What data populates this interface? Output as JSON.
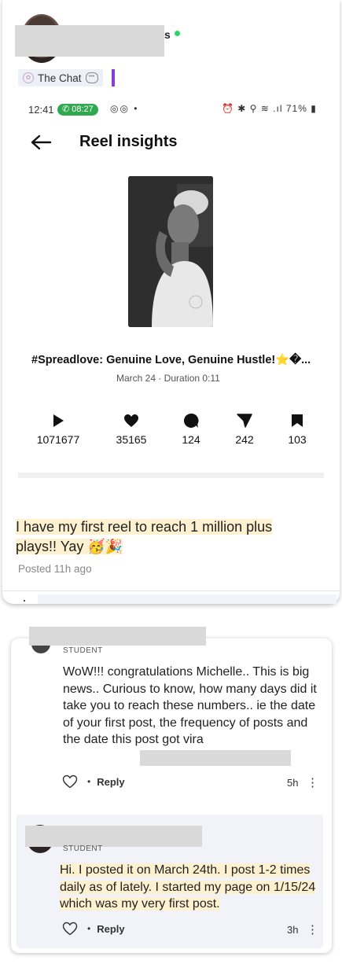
{
  "header": {
    "name_tail": "s",
    "chat_tag_label": "The Chat",
    "close_glyph": "✕",
    "more_glyph": "⋮"
  },
  "phone": {
    "status_time": "12:41",
    "call_time": "08:27",
    "status_left_icons": "◎◎ •",
    "status_right_icons": "⏰ ✱ ⚲ ≋ .ıl",
    "battery": "71%"
  },
  "reel": {
    "title": "Reel insights",
    "caption": "#Spreadlove: Genuine Love, Genuine Hustle!⭐�...",
    "meta": "March 24 · Duration 0:11",
    "stats": [
      {
        "icon": "play-icon",
        "value": "1071677"
      },
      {
        "icon": "heart-icon",
        "value": "35165"
      },
      {
        "icon": "comment-icon",
        "value": "124"
      },
      {
        "icon": "share-icon",
        "value": "242"
      },
      {
        "icon": "bookmark-icon",
        "value": "103"
      }
    ]
  },
  "post": {
    "body_line1": "I have my first reel to reach 1 million plus",
    "body_line2": "plays!! Yay 🥳🎉",
    "posted": "Posted 11h ago"
  },
  "comment": {
    "role": "STUDENT",
    "text": "WoW!!! congratulations Michelle.. This is big news.. Curious to know, how many days did it take you to reach these numbers.. ie the date of your first post, the frequency of posts and the date this post got vira",
    "reply_label": "Reply",
    "time": "5h"
  },
  "reply": {
    "role": "STUDENT",
    "text": "Hi. I posted it on March 24th. I post 1-2 times daily as of lately. I started my page on 1/15/24 which was my very first post.",
    "reply_label": "Reply",
    "time": "3h"
  },
  "colors": {
    "highlight": "#fdf1d0",
    "online": "#2bd66b",
    "call_pill": "#2fa84f",
    "chat_accent": "#8b3bd6"
  }
}
